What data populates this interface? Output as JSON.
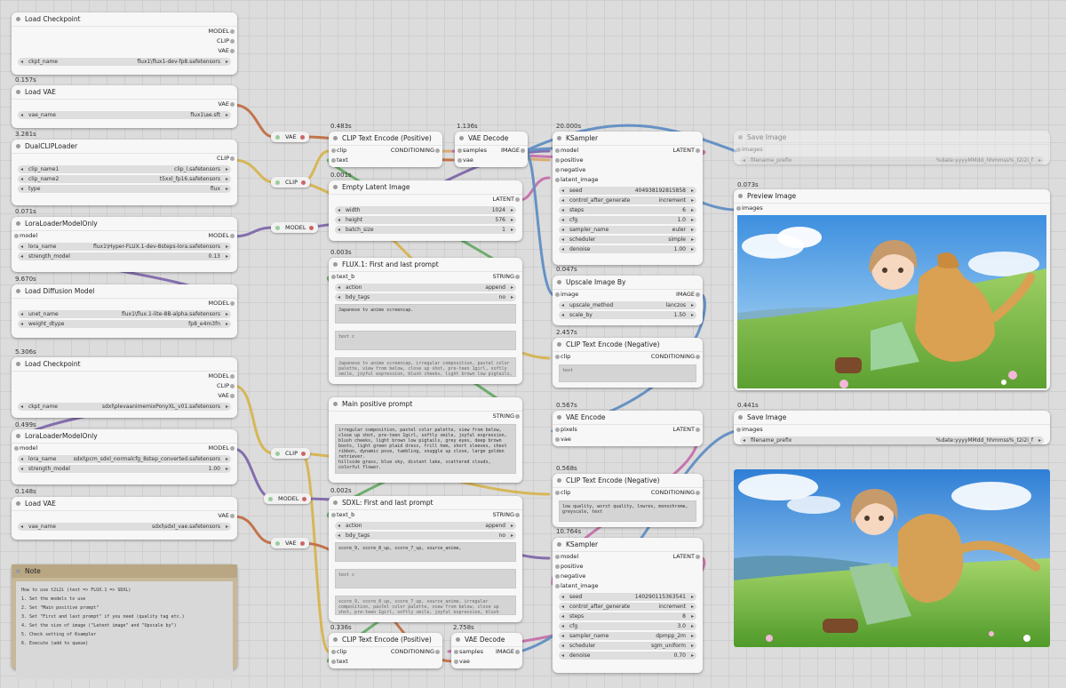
{
  "colors": {
    "canvas": "#dcdcdc",
    "node": "#f7f7f7",
    "note": "#c8b89a"
  },
  "nodes": {
    "ckpt1": {
      "title": "Load Checkpoint",
      "outputs": [
        "MODEL",
        "CLIP",
        "VAE"
      ],
      "ckpt_name_label": "ckpt_name",
      "ckpt_name": "flux1\\flux1-dev-fp8.safetensors",
      "time": "0.157s"
    },
    "vae1": {
      "title": "Load VAE",
      "output": "VAE",
      "vae_name_label": "vae_name",
      "vae_name": "flux1\\ae.sft",
      "time": "3.281s"
    },
    "dualclip": {
      "title": "DualCLIPLoader",
      "output": "CLIP",
      "clip_name1_label": "clip_name1",
      "clip_name1": "clip_l.safetensors",
      "clip_name2_label": "clip_name2",
      "clip_name2": "t5xxl_fp16.safetensors",
      "type_label": "type",
      "type": "flux",
      "time": "0.071s"
    },
    "lora1": {
      "title": "LoraLoaderModelOnly",
      "input": "model",
      "output": "MODEL",
      "lora_name_label": "lora_name",
      "lora_name": "flux1\\Hyper-FLUX.1-dev-8steps-lora.safetensors",
      "strength_label": "strength_model",
      "strength": "0.13",
      "time": "9.670s"
    },
    "unet": {
      "title": "Load Diffusion Model",
      "output": "MODEL",
      "unet_name_label": "unet_name",
      "unet_name": "flux1\\flux.1-lite-8B-alpha.safetensors",
      "dtype_label": "weight_dtype",
      "dtype": "fp8_e4m3fn",
      "time": "5.306s"
    },
    "ckpt2": {
      "title": "Load Checkpoint",
      "outputs": [
        "MODEL",
        "CLIP",
        "VAE"
      ],
      "ckpt_name_label": "ckpt_name",
      "ckpt_name": "sdxl\\plevaanimemixPonyXL_v01.safetensors",
      "time": "0.499s"
    },
    "lora2": {
      "title": "LoraLoaderModelOnly",
      "input": "model",
      "output": "MODEL",
      "lora_name_label": "lora_name",
      "lora_name": "sdxl\\pcm_sdxl_normalcfg_8step_converted.safetensors",
      "strength_label": "strength_model",
      "strength": "1.00",
      "time": "0.148s"
    },
    "vae2": {
      "title": "Load VAE",
      "output": "VAE",
      "vae_name_label": "vae_name",
      "vae_name": "sdxl\\sdxl_vae.safetensors"
    },
    "clip_pos1": {
      "title": "CLIP Text Encode (Positive)",
      "inputs": [
        "clip",
        "text"
      ],
      "output": "CONDITIONING",
      "time": "0.483s"
    },
    "empty_latent": {
      "title": "Empty Latent Image",
      "output": "LATENT",
      "width_label": "width",
      "width": "1024",
      "height_label": "height",
      "height": "576",
      "batch_label": "batch_size",
      "batch": "1",
      "time": "0.001s"
    },
    "flux_prompt": {
      "title": "FLUX.1: First and last prompt",
      "input": "text_b",
      "output": "STRING",
      "action_label": "action",
      "action": "append",
      "bdy_label": "bdy_tags",
      "bdy": "no",
      "text1": "Japanese tv anime screencap.",
      "text2": "text c",
      "text3": "Japanese tv anime screencap, irregular composition, pastel color palette, view from below, close up shot, pre-teen 1girl, softly smile, joyful expression, blush cheeks, light brown low pigtails, grey eyes, deep brown boots, light green plaid dress...",
      "time": "0.003s"
    },
    "main_prompt": {
      "title": "Main positive prompt",
      "output": "STRING",
      "text": "irregular composition, pastel color palette, view from below, close up shot, pre-teen 1girl, softly smile, joyful expression, blush cheeks, light brown low pigtails, grey eyes, deep brown boots, light green plaid dress, frill hem, short sleeves, chest ribbon, dynamic pose, tumbling, snuggle up close, large golden retriever.\nhillside grass, blue sky, distant lake, scattered clouds, colorful flower.",
      "time": ""
    },
    "sdxl_prompt": {
      "title": "SDXL: First and last prompt",
      "input": "text_b",
      "output": "STRING",
      "action_label": "action",
      "action": "append",
      "bdy_label": "bdy_tags",
      "bdy": "no",
      "text1": "score_9, score_8_up, score_7_up, source_anime,",
      "text2": "text c",
      "text3": "score_9, score_8_up, score_7_up, source_anime, irregular composition, pastel color palette, view from below, close up shot, pre-teen 1girl, softly smile, joyful expression, blush cheeks, light brown low pigtails, grey eyes, deep brown boots...",
      "time": "0.002s"
    },
    "clip_pos2": {
      "title": "CLIP Text Encode (Positive)",
      "inputs": [
        "clip",
        "text"
      ],
      "output": "CONDITIONING",
      "time": "0.336s"
    },
    "vae_decode1": {
      "title": "VAE Decode",
      "inputs": [
        "samples",
        "vae"
      ],
      "output": "IMAGE",
      "time": "1.136s"
    },
    "vae_decode2": {
      "title": "VAE Decode",
      "inputs": [
        "samples",
        "vae"
      ],
      "output": "IMAGE",
      "time": "2.758s"
    },
    "ksampler1": {
      "title": "KSampler",
      "inputs": [
        "model",
        "positive",
        "negative",
        "latent_image"
      ],
      "output": "LATENT",
      "widgets": [
        [
          "seed",
          "404938192815858"
        ],
        [
          "control_after_generate",
          "increment"
        ],
        [
          "steps",
          "6"
        ],
        [
          "cfg",
          "1.0"
        ],
        [
          "sampler_name",
          "euler"
        ],
        [
          "scheduler",
          "simple"
        ],
        [
          "denoise",
          "1.00"
        ]
      ],
      "time": "20.000s"
    },
    "upscale": {
      "title": "Upscale Image By",
      "input": "image",
      "output": "IMAGE",
      "method_label": "upscale_method",
      "method": "lanczos",
      "scale_label": "scale_by",
      "scale": "1.50",
      "time": "0.047s"
    },
    "clip_neg1": {
      "title": "CLIP Text Encode (Negative)",
      "input": "clip",
      "output": "CONDITIONING",
      "text": "text",
      "time": "2.457s"
    },
    "vae_encode": {
      "title": "VAE Encode",
      "inputs": [
        "pixels",
        "vae"
      ],
      "output": "LATENT",
      "time": "0.567s"
    },
    "clip_neg2": {
      "title": "CLIP Text Encode (Negative)",
      "input": "clip",
      "output": "CONDITIONING",
      "text": "low quality, worst quality, lowres, monochrome, greyscale, text",
      "time": "0.568s"
    },
    "ksampler2": {
      "title": "KSampler",
      "inputs": [
        "model",
        "positive",
        "negative",
        "latent_image"
      ],
      "output": "LATENT",
      "widgets": [
        [
          "seed",
          "140290115363541"
        ],
        [
          "control_after_generate",
          "increment"
        ],
        [
          "steps",
          "8"
        ],
        [
          "cfg",
          "3.0"
        ],
        [
          "sampler_name",
          "dpmpp_2m"
        ],
        [
          "scheduler",
          "sgm_uniform"
        ],
        [
          "denoise",
          "0.70"
        ]
      ],
      "time": "10.764s"
    },
    "save1": {
      "title": "Save Image",
      "input": "images",
      "prefix_label": "filename_prefix",
      "prefix": "%date:yyyyMMdd_hhmmss%_t2i2i_f"
    },
    "preview": {
      "title": "Preview Image",
      "input": "images",
      "time": "0.073s"
    },
    "save2": {
      "title": "Save Image",
      "input": "images",
      "prefix_label": "filename_prefix",
      "prefix": "%date:yyyyMMdd_hhmmss%_t2i2i_f",
      "time": "0.441s"
    }
  },
  "reroutes": {
    "vae1": "VAE",
    "clip1": "CLIP",
    "model1": "MODEL",
    "clip2": "CLIP",
    "model2": "MODEL",
    "vae2": "VAE"
  },
  "note": {
    "title": "Note",
    "lines": [
      "How to use t2i2i (text => FLUX.1 => SDXL)",
      "1. Set the models to use",
      "2. Set \"Main positive prompt\"",
      "3. Set \"First and last prompt\" if you need (quality tag etc.)",
      "4. Set the size of image (\"Latent image\" and \"Upscale by\")",
      "5. Check setting of Ksampler",
      "6. Execute (add to queue)"
    ]
  }
}
